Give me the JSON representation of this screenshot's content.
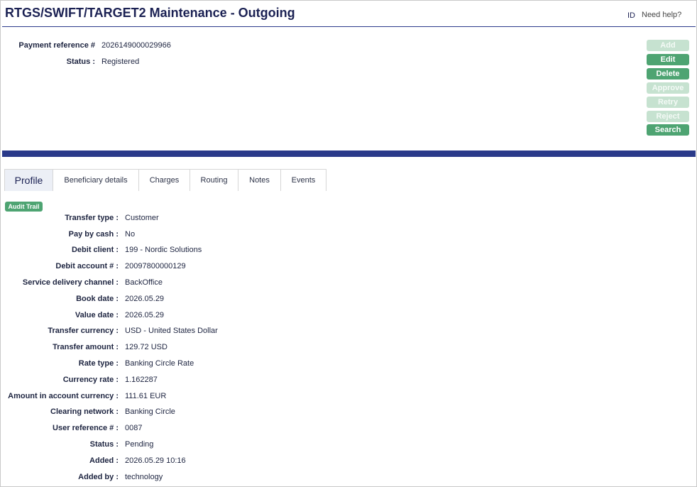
{
  "header": {
    "title": "RTGS/SWIFT/TARGET2 Maintenance - Outgoing",
    "id_label": "ID",
    "help_label": "Need help?"
  },
  "summary": [
    {
      "label": "Payment reference #",
      "value": "2026149000029966"
    },
    {
      "label": "Status :",
      "value": "Registered"
    }
  ],
  "actions": [
    {
      "label": "Add",
      "enabled": false
    },
    {
      "label": "Edit",
      "enabled": true
    },
    {
      "label": "Delete",
      "enabled": true
    },
    {
      "label": "Approve",
      "enabled": false
    },
    {
      "label": "Retry",
      "enabled": false
    },
    {
      "label": "Reject",
      "enabled": false
    },
    {
      "label": "Search",
      "enabled": true
    }
  ],
  "tabs": [
    {
      "label": "Profile",
      "active": true
    },
    {
      "label": "Beneficiary details",
      "active": false
    },
    {
      "label": "Charges",
      "active": false
    },
    {
      "label": "Routing",
      "active": false
    },
    {
      "label": "Notes",
      "active": false
    },
    {
      "label": "Events",
      "active": false
    }
  ],
  "audit_trail_label": "Audit Trail",
  "profile": [
    {
      "label": "Transfer type :",
      "value": "Customer"
    },
    {
      "label": "Pay by cash :",
      "value": "No"
    },
    {
      "label": "Debit client :",
      "value": "199 - Nordic Solutions"
    },
    {
      "label": "Debit account # :",
      "value": "20097800000129"
    },
    {
      "label": "Service delivery channel :",
      "value": "BackOffice"
    },
    {
      "label": "Book date :",
      "value": "2026.05.29"
    },
    {
      "label": "Value date :",
      "value": "2026.05.29"
    },
    {
      "label": "Transfer currency :",
      "value": "USD - United States Dollar"
    },
    {
      "label": "Transfer amount :",
      "value": "129.72 USD"
    },
    {
      "label": "Rate type :",
      "value": "Banking Circle Rate"
    },
    {
      "label": "Currency rate :",
      "value": "1.162287"
    },
    {
      "label": "Amount in account currency :",
      "value": "111.61 EUR"
    },
    {
      "label": "Clearing network :",
      "value": "Banking Circle"
    },
    {
      "label": "User reference # :",
      "value": "0087"
    },
    {
      "label": "Status :",
      "value": "Pending"
    },
    {
      "label": "Added :",
      "value": "2026.05.29 10:16"
    },
    {
      "label": "Added by :",
      "value": "technology"
    }
  ],
  "colors": {
    "accent_green": "#4ea472",
    "disabled_green": "#c6e2d0",
    "navy": "#2a3a8a",
    "title": "#1b2153"
  }
}
